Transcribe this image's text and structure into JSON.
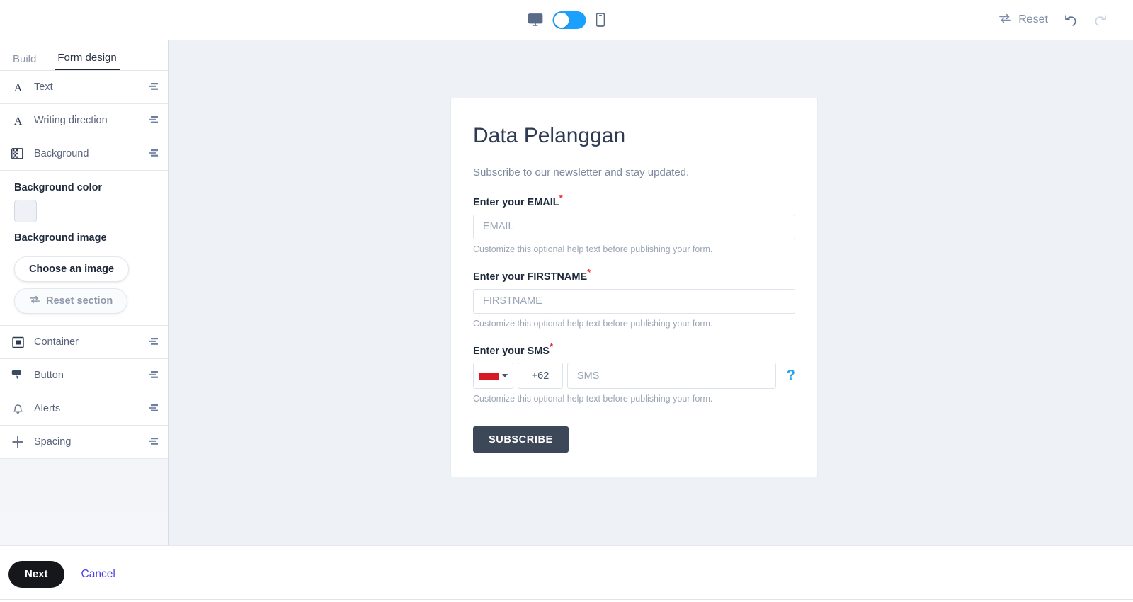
{
  "toolbar": {
    "desktop_icon": "desktop-monitor-icon",
    "mobile_icon": "mobile-phone-icon",
    "toggle_state": "desktop",
    "reset_label": "Reset",
    "reset_icon": "cycle-arrows-icon",
    "undo_icon": "undo-arrow-icon",
    "redo_icon": "redo-arrow-icon"
  },
  "sidebar": {
    "tabs": [
      {
        "label": "Build",
        "active": false
      },
      {
        "label": "Form design",
        "active": true
      }
    ],
    "rows": [
      {
        "label": "Text",
        "icon": "serif-a-icon"
      },
      {
        "label": "Writing direction",
        "icon": "serif-a-icon"
      },
      {
        "label": "Background",
        "icon": "checkered-image-icon"
      }
    ],
    "background_panel": {
      "color_title": "Background color",
      "color_value": "#eef1f6",
      "image_title": "Background image",
      "choose_image_label": "Choose an image",
      "reset_section_label": "Reset section",
      "reset_section_icon": "cycle-arrows-icon"
    },
    "rows2": [
      {
        "label": "Container",
        "icon": "container-square-icon"
      },
      {
        "label": "Button",
        "icon": "click-button-icon"
      },
      {
        "label": "Alerts",
        "icon": "bell-icon"
      },
      {
        "label": "Spacing",
        "icon": "spacing-divider-icon"
      }
    ],
    "handle_icon": "drag-handle-icon"
  },
  "form": {
    "title": "Data Pelanggan",
    "subtitle": "Subscribe to our newsletter and stay updated.",
    "fields": [
      {
        "label": "Enter your EMAIL",
        "required": "*",
        "placeholder": "EMAIL",
        "value": "",
        "help": "Customize this optional help text before publishing your form."
      },
      {
        "label": "Enter your FIRSTNAME",
        "required": "*",
        "placeholder": "FIRSTNAME",
        "value": "",
        "help": "Customize this optional help text before publishing your form."
      }
    ],
    "sms_field": {
      "label": "Enter your SMS",
      "required": "*",
      "flag": "indonesia-flag",
      "flag_color": "#d81824",
      "dial_code": "+62",
      "placeholder": "SMS",
      "value": "",
      "help": "Customize this optional help text before publishing your form.",
      "help_icon": "question-mark-icon"
    },
    "submit_label": "SUBSCRIBE",
    "submit_color": "#3c4858"
  },
  "footer": {
    "next_label": "Next",
    "cancel_label": "Cancel",
    "cancel_color": "#4b42e8"
  }
}
